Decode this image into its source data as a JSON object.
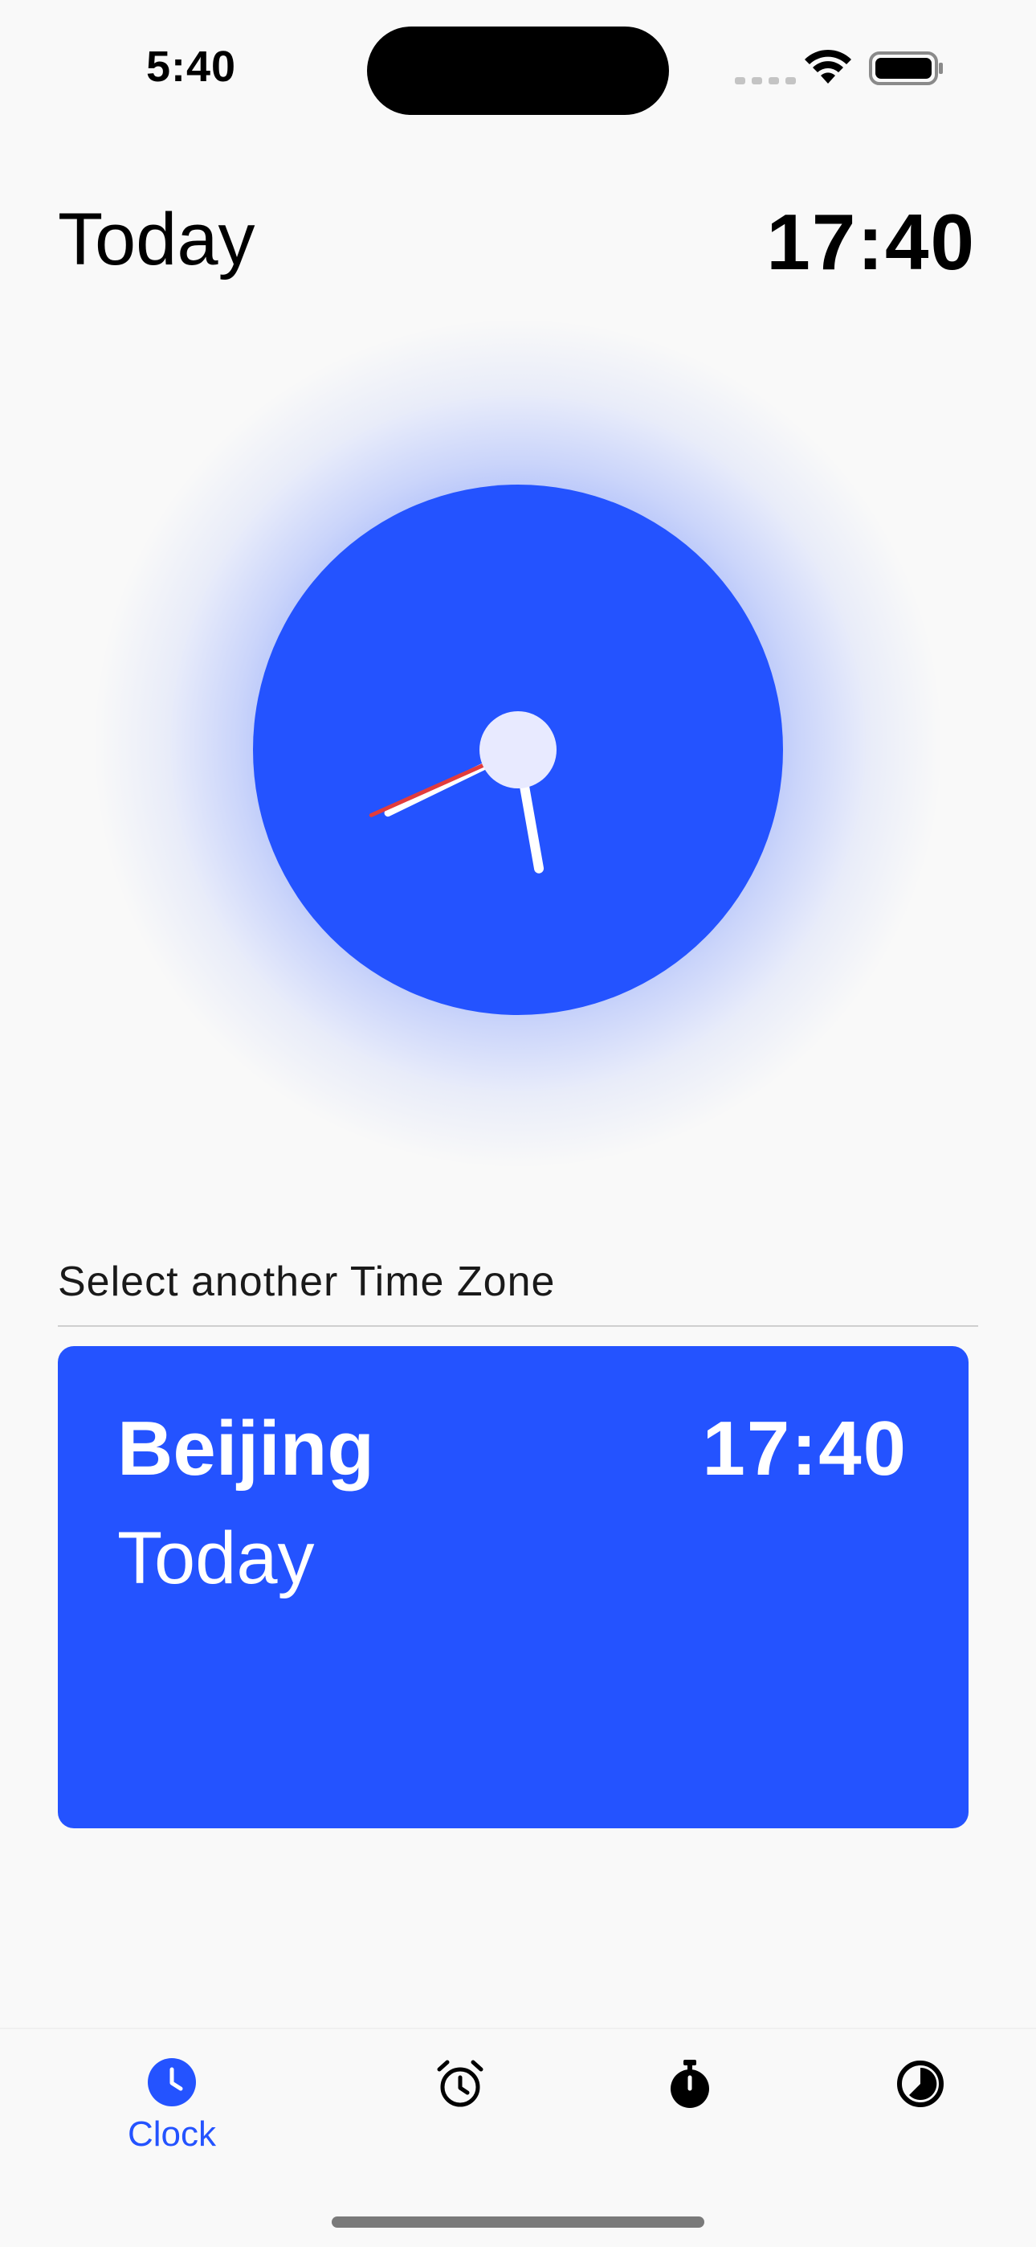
{
  "status_bar": {
    "time": "5:40"
  },
  "header": {
    "day": "Today",
    "time": "17:40"
  },
  "clock": {
    "hour": 17,
    "minute": 40,
    "second": 41,
    "colors": {
      "face": "#2453ff",
      "hands": "#ffffff",
      "second_hand": "#e23c3c",
      "center": "#e8eaff"
    }
  },
  "time_zone": {
    "label": "Select another Time Zone",
    "card": {
      "city": "Beijing",
      "time": "17:40",
      "day": "Today"
    }
  },
  "nav": {
    "items": [
      {
        "label": "Clock",
        "icon": "clock-icon",
        "active": true
      },
      {
        "label": "",
        "icon": "alarm-icon",
        "active": false
      },
      {
        "label": "",
        "icon": "stopwatch-icon",
        "active": false
      },
      {
        "label": "",
        "icon": "timer-icon",
        "active": false
      }
    ]
  },
  "accent_color": "#2453ff"
}
